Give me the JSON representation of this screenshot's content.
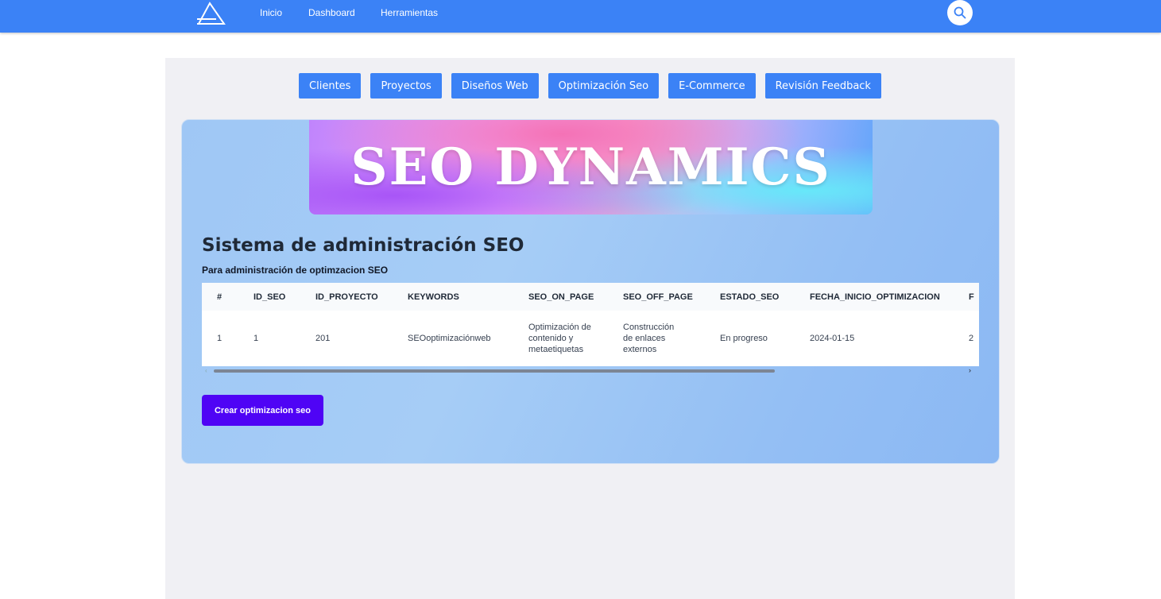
{
  "nav": {
    "links": [
      "Inicio",
      "Dashboard",
      "Herramientas"
    ],
    "search_icon": "search-icon",
    "logo_icon": "logo-icon"
  },
  "tabs": [
    "Clientes",
    "Proyectos",
    "Diseños Web",
    "Optimización Seo",
    "E-Commerce",
    "Revisión Feedback"
  ],
  "banner": {
    "text": "SEO DYNAMICS"
  },
  "main": {
    "title": "Sistema de administración SEO",
    "subtitle": "Para administración de optimzacion SEO",
    "create_button": "Crear optimizacion seo"
  },
  "table": {
    "headers": [
      "#",
      "ID_SEO",
      "ID_PROYECTO",
      "KEYWORDS",
      "SEO_ON_PAGE",
      "SEO_OFF_PAGE",
      "ESTADO_SEO",
      "FECHA_INICIO_OPTIMIZACION",
      "F"
    ],
    "rows": [
      [
        "1",
        "1",
        "201",
        "SEOoptimizaciónweb",
        "Optimización de contenido y metaetiquetas",
        "Construcción de enlaces externos",
        "En progreso",
        "2024-01-15",
        "2"
      ]
    ]
  },
  "colors": {
    "navbar": "#3b82f6",
    "tab": "#3b82f6",
    "create_button": "#4f04f5"
  }
}
